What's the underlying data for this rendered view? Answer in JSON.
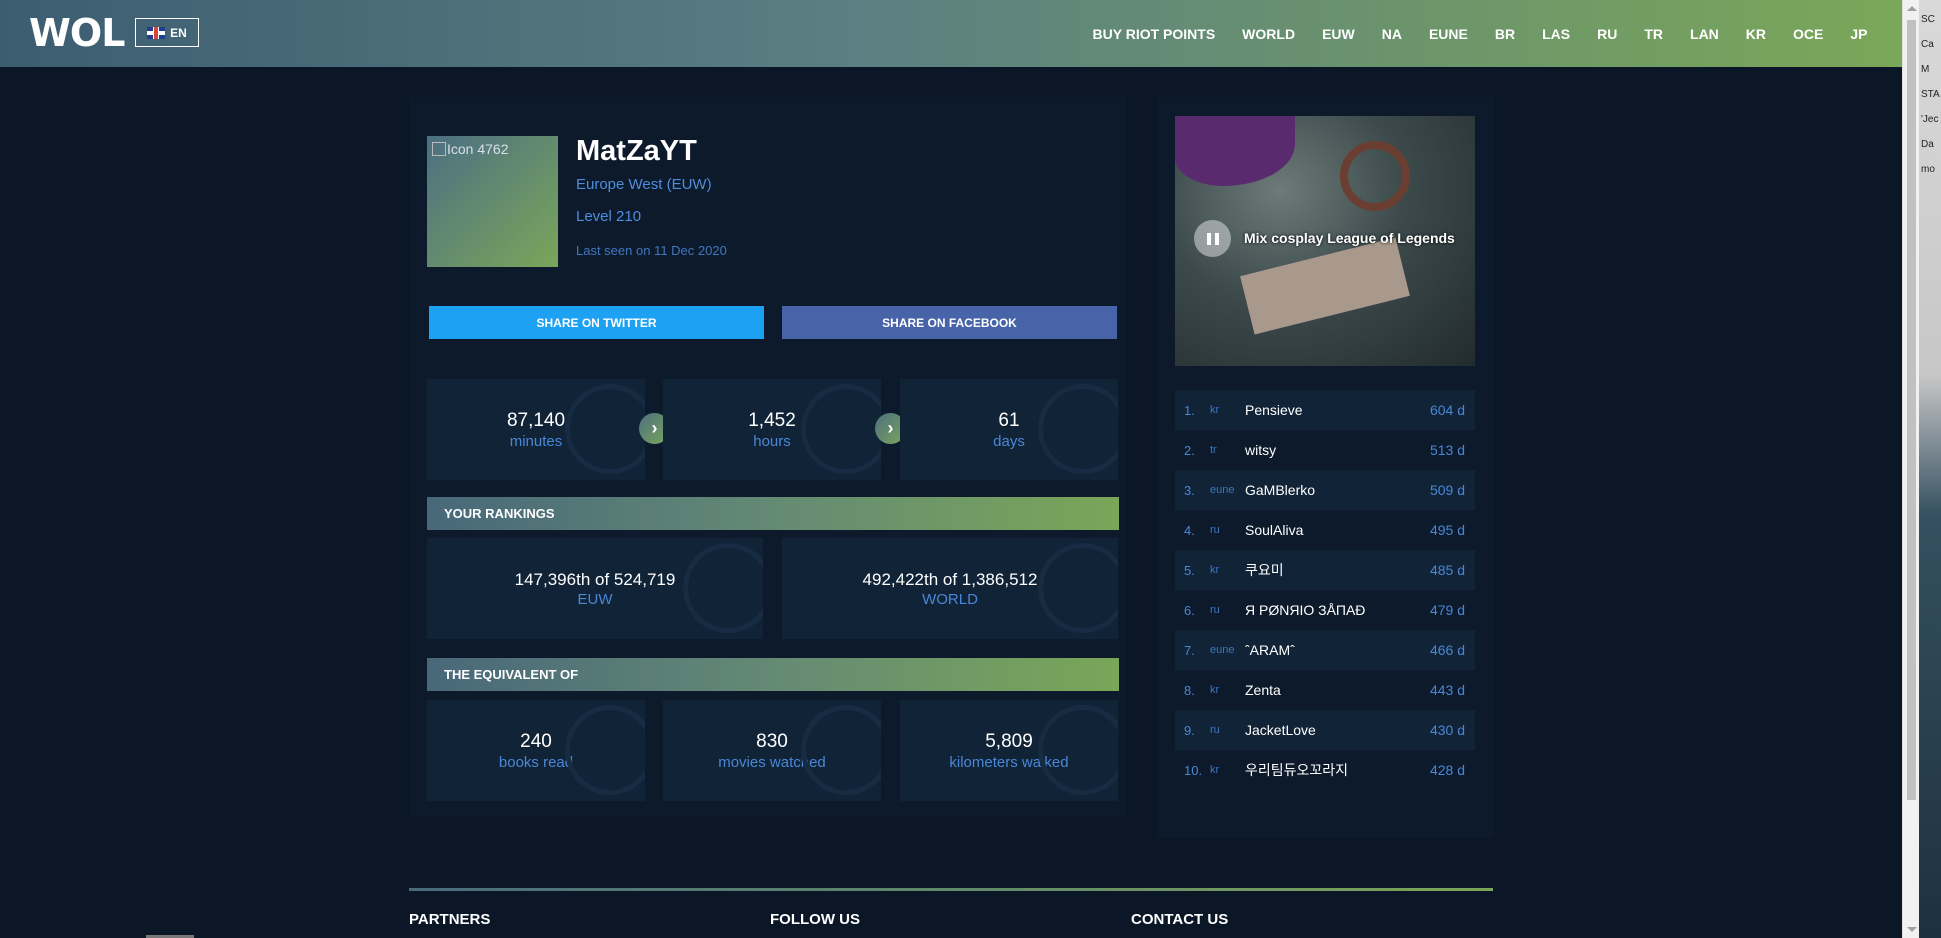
{
  "header": {
    "logo": "WOL",
    "language": "EN",
    "nav": [
      "BUY RIOT POINTS",
      "WORLD",
      "EUW",
      "NA",
      "EUNE",
      "BR",
      "LAS",
      "RU",
      "TR",
      "LAN",
      "KR",
      "OCE",
      "JP"
    ]
  },
  "profile": {
    "icon_alt": "Icon 4762",
    "name": "MatZaYT",
    "region": "Europe West (EUW)",
    "level": "Level 210",
    "last_seen": "Last seen on 11 Dec 2020"
  },
  "share": {
    "twitter": "SHARE ON TWITTER",
    "facebook": "SHARE ON FACEBOOK"
  },
  "time": [
    {
      "value": "87,140",
      "unit": "minutes"
    },
    {
      "value": "1,452",
      "unit": "hours"
    },
    {
      "value": "61",
      "unit": "days"
    }
  ],
  "rankings": {
    "title": "YOUR RANKINGS",
    "items": [
      {
        "value": "147,396th of 524,719",
        "label": "EUW"
      },
      {
        "value": "492,422th of 1,386,512",
        "label": "WORLD"
      }
    ]
  },
  "equivalent": {
    "title": "THE EQUIVALENT OF",
    "items": [
      {
        "value": "240",
        "label": "books read"
      },
      {
        "value": "830",
        "label": "movies watched"
      },
      {
        "value": "5,809",
        "label": "kilometers walked"
      }
    ]
  },
  "video": {
    "title": "Mix cosplay League of Legends"
  },
  "leaderboard": [
    {
      "rank": "1.",
      "region": "kr",
      "name": "Pensieve",
      "days": "604 d"
    },
    {
      "rank": "2.",
      "region": "tr",
      "name": "witsy",
      "days": "513 d"
    },
    {
      "rank": "3.",
      "region": "eune",
      "name": "GaMBlerko",
      "days": "509 d"
    },
    {
      "rank": "4.",
      "region": "ru",
      "name": "SoulAliva",
      "days": "495 d"
    },
    {
      "rank": "5.",
      "region": "kr",
      "name": "쿠요미",
      "days": "485 d"
    },
    {
      "rank": "6.",
      "region": "ru",
      "name": "Я PØNЯIO ЗÅПАÐ",
      "days": "479 d"
    },
    {
      "rank": "7.",
      "region": "eune",
      "name": "ˆARAMˆ",
      "days": "466 d"
    },
    {
      "rank": "8.",
      "region": "kr",
      "name": "Zenta",
      "days": "443 d"
    },
    {
      "rank": "9.",
      "region": "ru",
      "name": "JacketLove",
      "days": "430 d"
    },
    {
      "rank": "10.",
      "region": "kr",
      "name": "우리팀듀오꼬라지",
      "days": "428 d"
    }
  ],
  "footer": {
    "partners": "PARTNERS",
    "follow": "FOLLOW US",
    "contact": "CONTACT US"
  },
  "desktop_fragments": [
    "SC",
    "Ca",
    "M",
    "STA",
    "'Jec",
    "Da",
    "mo"
  ]
}
